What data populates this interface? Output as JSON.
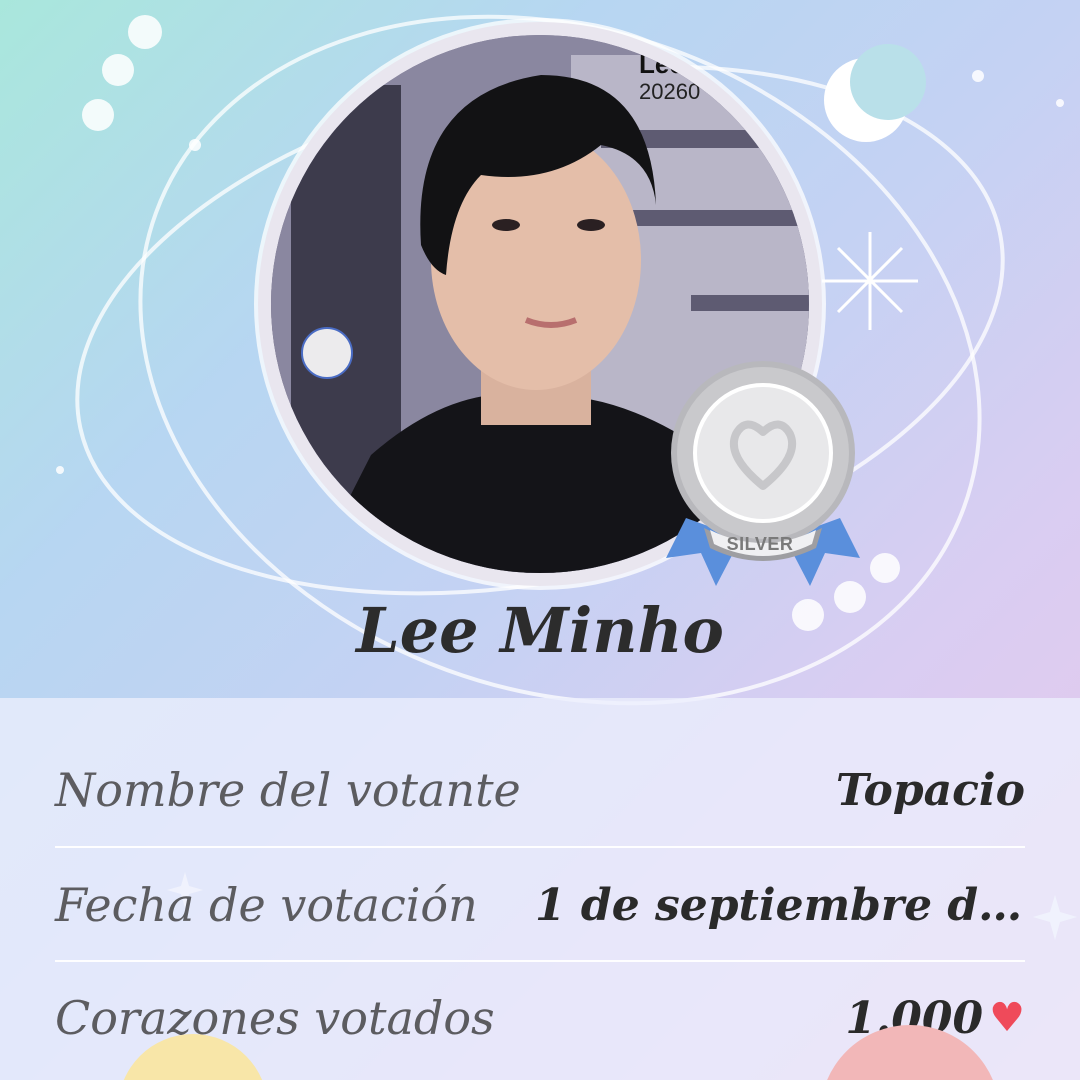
{
  "artist": {
    "name": "Lee Minho",
    "photo_caption_name": "Lee",
    "photo_caption_date": "20260"
  },
  "badge": {
    "label": "SILVER",
    "icon": "heart-outline-icon"
  },
  "vote_details": {
    "rows": [
      {
        "label": "Nombre del votante",
        "value": "Topacio"
      },
      {
        "label": "Fecha de votación",
        "value": "1 de septiembre de ..."
      },
      {
        "label": "Corazones votados",
        "value": "1.000"
      }
    ]
  },
  "icons": {
    "heart": "♥",
    "moon": "moon-icon",
    "sparkle": "sparkle-icon"
  },
  "colors": {
    "heart": "#ef4a5a",
    "medal_silver": "#c9c9cc",
    "ribbon": "#5a8fdc"
  }
}
